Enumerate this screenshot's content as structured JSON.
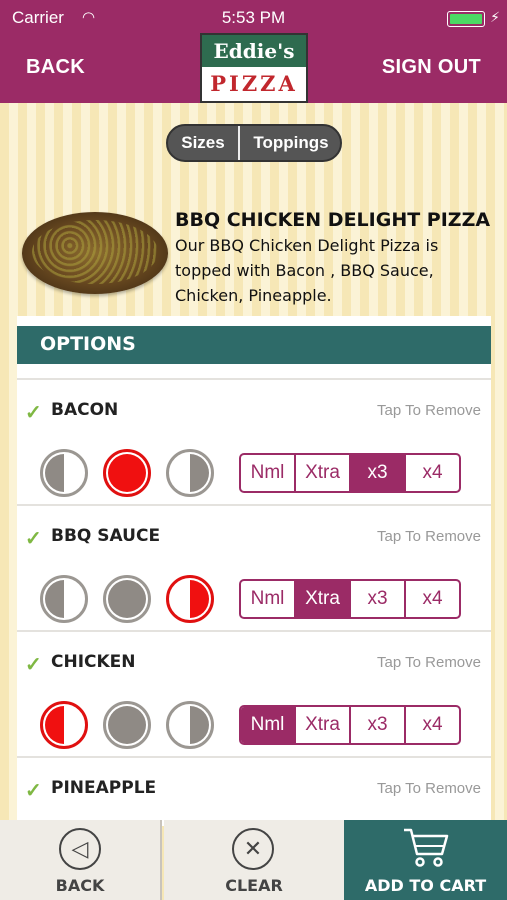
{
  "status": {
    "carrier": "Carrier",
    "time": "5:53 PM",
    "battery_level": 1.0
  },
  "header": {
    "back_label": "BACK",
    "signout_label": "SIGN OUT",
    "logo_top": "Eddie's",
    "logo_bottom": "PIZZA"
  },
  "tabs": [
    {
      "label": "Sizes"
    },
    {
      "label": "Toppings"
    }
  ],
  "product": {
    "title": "BBQ CHICKEN DELIGHT PIZZA",
    "description": "Our BBQ Chicken Delight Pizza is topped with Bacon , BBQ Sauce, Chicken, Pineapple."
  },
  "options": {
    "title": "OPTIONS",
    "remove_label": "Tap To Remove",
    "amount_labels": [
      "Nml",
      "Xtra",
      "x3",
      "x4"
    ],
    "toppings": [
      {
        "name": "BACON",
        "portion": "whole",
        "amount": "x3"
      },
      {
        "name": "BBQ SAUCE",
        "portion": "right-half",
        "amount": "Xtra"
      },
      {
        "name": "CHICKEN",
        "portion": "left-half",
        "amount": "Nml"
      },
      {
        "name": "PINEAPPLE"
      }
    ]
  },
  "bottom_bar": {
    "back_label": "BACK",
    "clear_label": "CLEAR",
    "add_to_cart_label": "ADD TO CART"
  },
  "colors": {
    "brand": "#9b2b66",
    "teal": "#2e6b69",
    "selected": "#f01010",
    "check": "#7fb843"
  }
}
